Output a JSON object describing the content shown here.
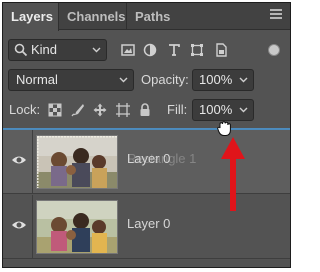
{
  "tabs": {
    "layers": "Layers",
    "channels": "Channels",
    "paths": "Paths"
  },
  "filter": {
    "kind_label": "Kind",
    "icons": [
      "pixel-filter-icon",
      "adjustment-filter-icon",
      "type-filter-icon",
      "shape-filter-icon",
      "smart-object-filter-icon"
    ]
  },
  "blend": {
    "mode": "Normal",
    "opacity_label": "Opacity:",
    "opacity_value": "100%"
  },
  "lock": {
    "label": "Lock:",
    "icons": [
      "lock-transparent-icon",
      "lock-image-icon",
      "lock-position-icon",
      "lock-artboard-icon",
      "lock-all-icon"
    ],
    "fill_label": "Fill:",
    "fill_value": "100%"
  },
  "layers": [
    {
      "name": "Layer 0",
      "ghost_name": "Rectangle 1",
      "visible": true,
      "dragging": true
    },
    {
      "name": "Layer 0",
      "visible": true,
      "dragging": false
    }
  ],
  "colors": {
    "panel_bg": "#535353",
    "drop_indicator": "#4a90c8",
    "arrow": "#e0141a"
  }
}
